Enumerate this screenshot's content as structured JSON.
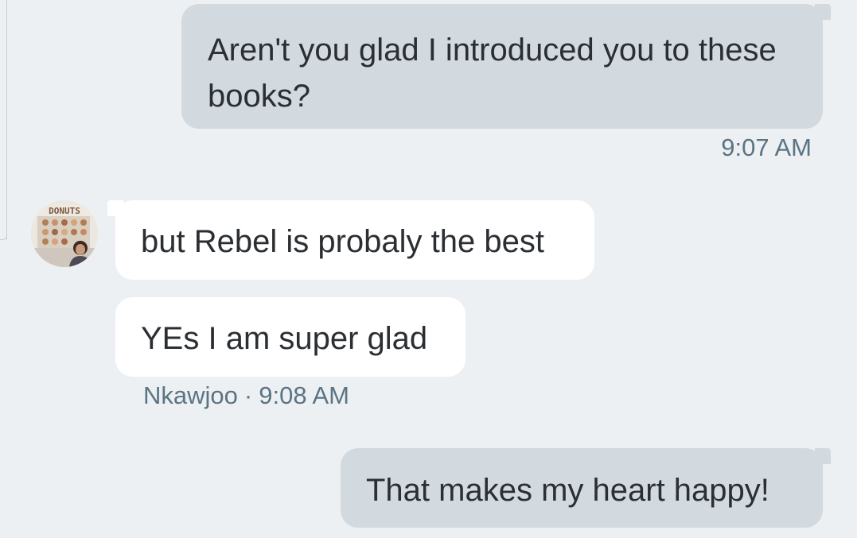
{
  "messages": [
    {
      "direction": "outgoing",
      "text": "Aren't you glad I introduced you to these books?",
      "time": "9:07 AM"
    },
    {
      "direction": "incoming",
      "text": "but Rebel is probaly the best"
    },
    {
      "direction": "incoming",
      "text": "YEs I am super glad"
    },
    {
      "direction": "outgoing",
      "text": "That makes my heart happy!"
    }
  ],
  "incoming_meta": {
    "sender": "Nkawjoo",
    "separator": "·",
    "time": "9:08 AM",
    "avatar_sign_text": "DONUTS"
  },
  "colors": {
    "background": "#edf0f3",
    "outgoing_bubble": "#d2d9df",
    "incoming_bubble": "#ffffff",
    "text": "#2b2f33",
    "meta_text": "#5b7483"
  }
}
